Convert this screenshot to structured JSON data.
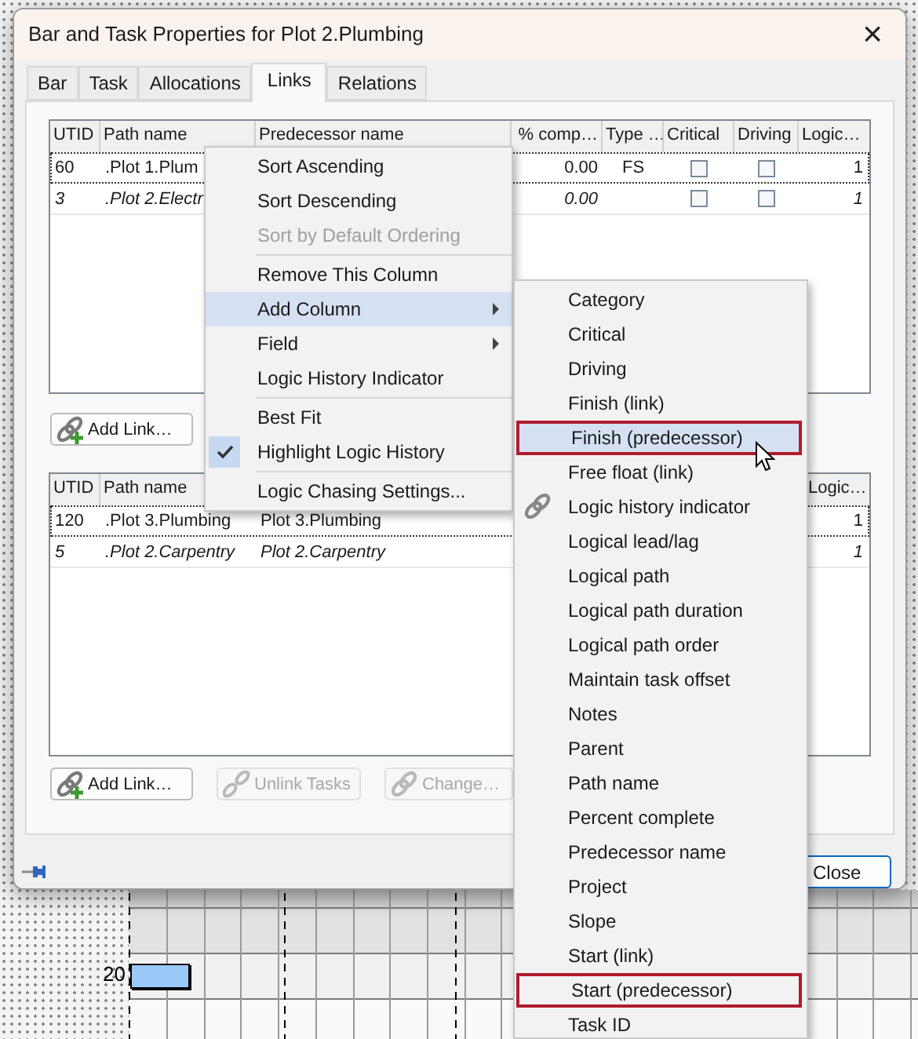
{
  "window": {
    "title": "Bar and Task Properties for Plot 2.Plumbing",
    "close_label": "×"
  },
  "tabs": [
    {
      "label": "Bar",
      "selected": false
    },
    {
      "label": "Task",
      "selected": false
    },
    {
      "label": "Allocations",
      "selected": false
    },
    {
      "label": "Links",
      "selected": true
    },
    {
      "label": "Relations",
      "selected": false
    }
  ],
  "predecessors": {
    "columns": [
      "UTID",
      "Path name",
      "Predecessor name",
      "% comp…",
      "Type …",
      "Critical",
      "Driving",
      "Logic…"
    ],
    "rows": [
      {
        "utid": "60",
        "path": ".Plot 1.Plum",
        "percent": "0.00",
        "type": "FS",
        "critical": false,
        "driving": false,
        "logic": "1",
        "italic": false,
        "focused": true
      },
      {
        "utid": "3",
        "path": ".Plot 2.Electr",
        "percent": "0.00",
        "critical": false,
        "driving": false,
        "logic": "1",
        "italic": true,
        "focused": false
      }
    ],
    "buttons": [
      {
        "label": "Add Link…",
        "disabled": false
      }
    ]
  },
  "successors": {
    "columns": [
      "UTID",
      "Path name",
      "Logic…"
    ],
    "rows": [
      {
        "utid": "120",
        "path": ".Plot 3.Plumbing",
        "name": "Plot 3.Plumbing",
        "logic": "1",
        "italic": false,
        "focused": true
      },
      {
        "utid": "5",
        "path": ".Plot 2.Carpentry",
        "name": "Plot 2.Carpentry",
        "logic": "1",
        "italic": true,
        "focused": false
      }
    ],
    "buttons": [
      {
        "label": "Add Link…",
        "disabled": false
      },
      {
        "label": "Unlink Tasks",
        "disabled": true
      },
      {
        "label": "Change…",
        "disabled": true
      }
    ]
  },
  "close_button": "Close",
  "gantt": {
    "row_label": "20"
  },
  "context_menu": [
    {
      "kind": "item",
      "label": "Sort Ascending",
      "disabled": false,
      "selected": false,
      "checked": false,
      "submenu": false
    },
    {
      "kind": "item",
      "label": "Sort Descending",
      "disabled": false,
      "selected": false,
      "checked": false,
      "submenu": false
    },
    {
      "kind": "item",
      "label": "Sort by Default Ordering",
      "disabled": true,
      "selected": false,
      "checked": false,
      "submenu": false
    },
    {
      "kind": "separator"
    },
    {
      "kind": "item",
      "label": "Remove This Column",
      "disabled": false,
      "selected": false,
      "checked": false,
      "submenu": false
    },
    {
      "kind": "item",
      "label": "Add Column",
      "disabled": false,
      "selected": true,
      "checked": false,
      "submenu": true
    },
    {
      "kind": "item",
      "label": "Field",
      "disabled": false,
      "selected": false,
      "checked": false,
      "submenu": true
    },
    {
      "kind": "item",
      "label": "Logic History Indicator",
      "disabled": false,
      "selected": false,
      "checked": false,
      "submenu": false
    },
    {
      "kind": "separator"
    },
    {
      "kind": "item",
      "label": "Best Fit",
      "disabled": false,
      "selected": false,
      "checked": false,
      "submenu": false
    },
    {
      "kind": "item",
      "label": "Highlight Logic History",
      "disabled": false,
      "selected": false,
      "checked": true,
      "submenu": false
    },
    {
      "kind": "separator"
    },
    {
      "kind": "item",
      "label": "Logic Chasing Settings...",
      "disabled": false,
      "selected": false,
      "checked": false,
      "submenu": false
    }
  ],
  "add_column_menu": [
    {
      "label": "Category",
      "selected": false,
      "outlined": false,
      "icon": false
    },
    {
      "label": "Critical",
      "selected": false,
      "outlined": false,
      "icon": false
    },
    {
      "label": "Driving",
      "selected": false,
      "outlined": false,
      "icon": false
    },
    {
      "label": "Finish (link)",
      "selected": false,
      "outlined": false,
      "icon": false
    },
    {
      "label": "Finish (predecessor)",
      "selected": true,
      "outlined": true,
      "icon": false
    },
    {
      "label": "Free float (link)",
      "selected": false,
      "outlined": false,
      "icon": false
    },
    {
      "label": "Logic history indicator",
      "selected": false,
      "outlined": false,
      "icon": true
    },
    {
      "label": "Logical lead/lag",
      "selected": false,
      "outlined": false,
      "icon": false
    },
    {
      "label": "Logical path",
      "selected": false,
      "outlined": false,
      "icon": false
    },
    {
      "label": "Logical path duration",
      "selected": false,
      "outlined": false,
      "icon": false
    },
    {
      "label": "Logical path order",
      "selected": false,
      "outlined": false,
      "icon": false
    },
    {
      "label": "Maintain task offset",
      "selected": false,
      "outlined": false,
      "icon": false
    },
    {
      "label": "Notes",
      "selected": false,
      "outlined": false,
      "icon": false
    },
    {
      "label": "Parent",
      "selected": false,
      "outlined": false,
      "icon": false
    },
    {
      "label": "Path name",
      "selected": false,
      "outlined": false,
      "icon": false
    },
    {
      "label": "Percent complete",
      "selected": false,
      "outlined": false,
      "icon": false
    },
    {
      "label": "Predecessor name",
      "selected": false,
      "outlined": false,
      "icon": false
    },
    {
      "label": "Project",
      "selected": false,
      "outlined": false,
      "icon": false
    },
    {
      "label": "Slope",
      "selected": false,
      "outlined": false,
      "icon": false
    },
    {
      "label": "Start (link)",
      "selected": false,
      "outlined": false,
      "icon": false
    },
    {
      "label": "Start (predecessor)",
      "selected": false,
      "outlined": true,
      "icon": false
    },
    {
      "label": "Task ID",
      "selected": false,
      "outlined": false,
      "icon": false
    }
  ]
}
